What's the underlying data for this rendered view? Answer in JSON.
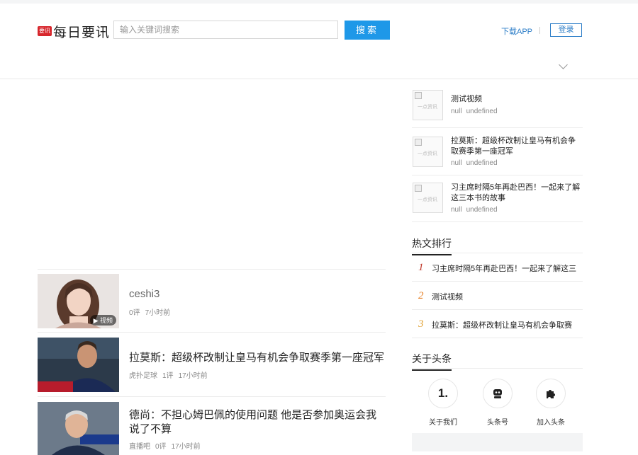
{
  "header": {
    "logo_badge": "要讯",
    "logo_text": "每日要讯",
    "search_placeholder": "输入关键词搜索",
    "search_button": "搜索",
    "download_link": "下载APP",
    "login_button": "登录"
  },
  "feed": [
    {
      "title": "ceshi3",
      "meta": [
        "0评",
        "7小时前"
      ],
      "badge": "视频"
    },
    {
      "title": "拉莫斯：超级杯改制让皇马有机会争取赛季第一座冠军",
      "meta": [
        "虎扑足球",
        "1评",
        "17小时前"
      ]
    },
    {
      "title": "德尚：不担心姆巴佩的使用问题 他是否参加奥运会我说了不算",
      "meta": [
        "直播吧",
        "0评",
        "17小时前"
      ]
    }
  ],
  "sidebar": {
    "placeholder_text": "一点资讯",
    "videos": [
      {
        "title": "测试视频",
        "meta": [
          "null",
          "undefined"
        ]
      },
      {
        "title": "拉莫斯：超级杯改制让皇马有机会争取赛季第一座冠军",
        "meta": [
          "null",
          "undefined"
        ]
      },
      {
        "title": "习主席时隔5年再赴巴西！一起来了解这三本书的故事",
        "meta": [
          "null",
          "undefined"
        ]
      }
    ],
    "hot_title": "热文排行",
    "hot": [
      {
        "rank": "1",
        "text": "习主席时隔5年再赴巴西！一起来了解这三",
        "color": "#c0392b"
      },
      {
        "rank": "2",
        "text": "测试视频",
        "color": "#e67e22"
      },
      {
        "rank": "3",
        "text": "拉莫斯：超级杯改制让皇马有机会争取赛",
        "color": "#e0a030"
      }
    ],
    "about_title": "关于头条",
    "about": [
      {
        "glyph": "1.",
        "label": "关于我们"
      },
      {
        "glyph": "",
        "label": "头条号"
      },
      {
        "glyph": "",
        "label": "加入头条"
      }
    ]
  }
}
